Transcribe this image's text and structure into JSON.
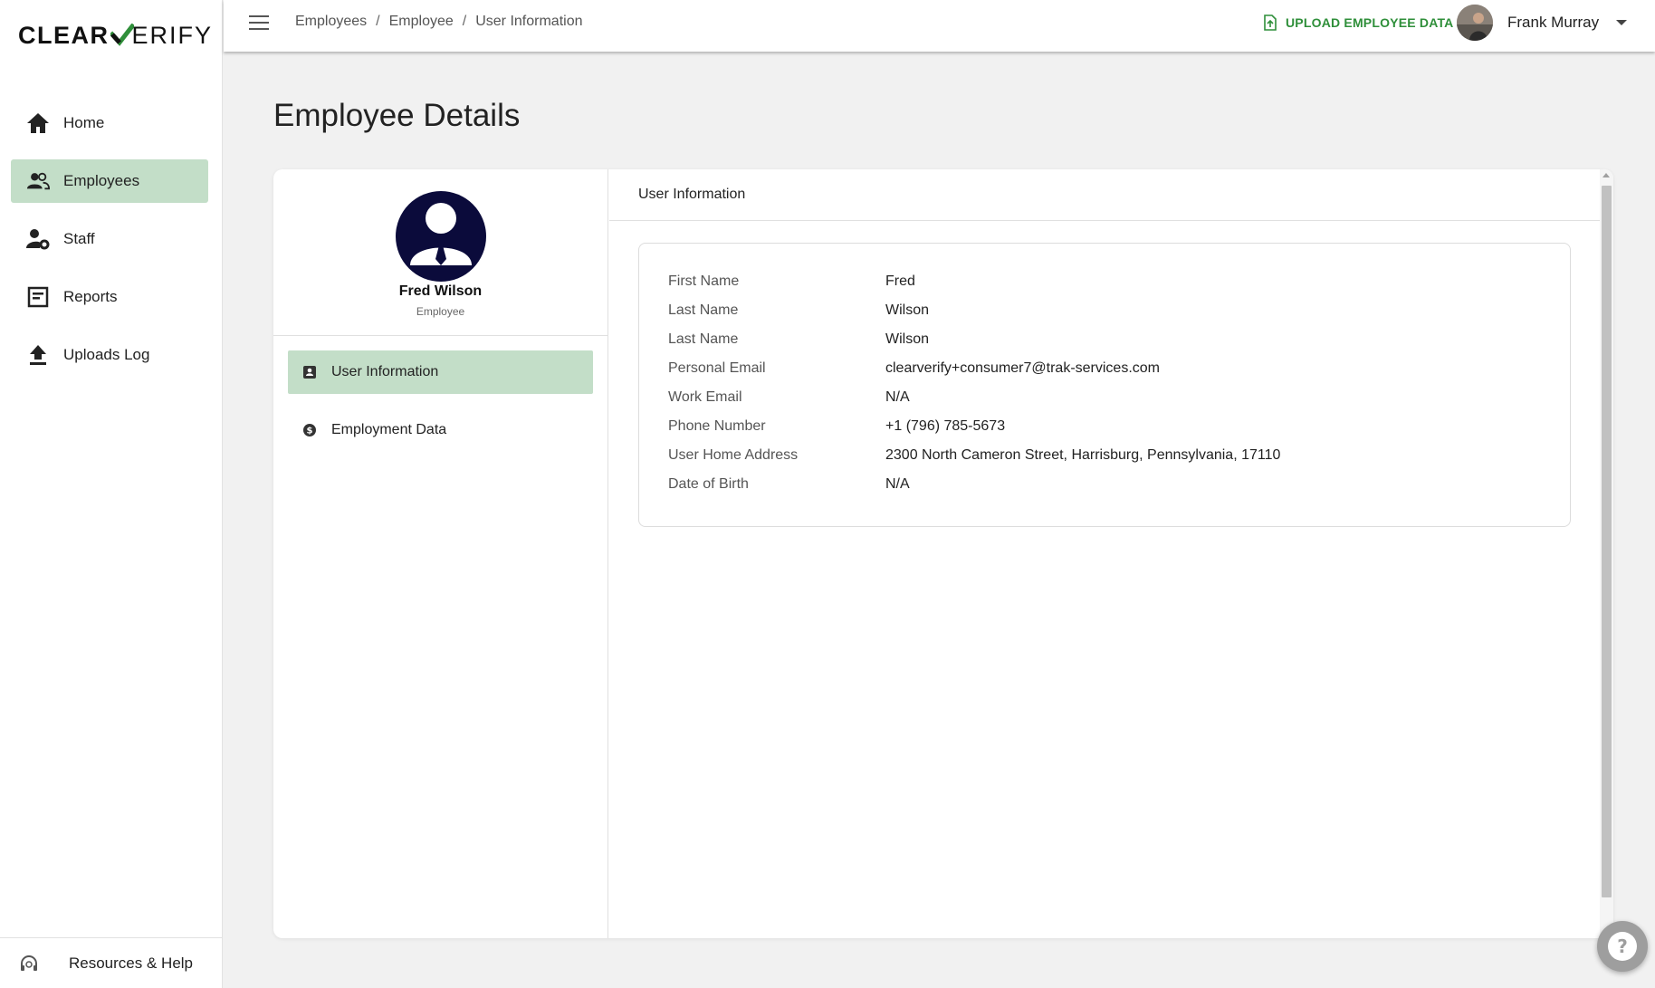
{
  "app": {
    "logo_part1": "CLEAR",
    "logo_part2": "ERIFY",
    "accent_color": "#2f8f3a",
    "active_bg": "#c3dec8"
  },
  "sidebar": {
    "items": [
      {
        "label": "Home",
        "icon": "home-icon"
      },
      {
        "label": "Employees",
        "icon": "people-icon",
        "active": true
      },
      {
        "label": "Staff",
        "icon": "staff-settings-icon"
      },
      {
        "label": "Reports",
        "icon": "report-icon"
      },
      {
        "label": "Uploads Log",
        "icon": "upload-icon"
      }
    ],
    "footer_label": "Resources & Help"
  },
  "header": {
    "breadcrumb": [
      "Employees",
      "Employee",
      "User Information"
    ],
    "breadcrumb_sep": "/",
    "upload_label": "UPLOAD EMPLOYEE DATA",
    "user_name": "Frank Murray"
  },
  "page": {
    "title": "Employee Details"
  },
  "profile": {
    "name": "Fred Wilson",
    "role": "Employee"
  },
  "side_menu": {
    "items": [
      {
        "label": "User Information",
        "icon": "contact-card-icon",
        "active": true
      },
      {
        "label": "Employment Data",
        "icon": "dollar-icon"
      }
    ]
  },
  "user_info": {
    "section_title": "User Information",
    "rows": [
      {
        "label": "First Name",
        "value": "Fred"
      },
      {
        "label": "Last Name",
        "value": "Wilson"
      },
      {
        "label": "Last Name",
        "value": "Wilson"
      },
      {
        "label": "Personal Email",
        "value": "clearverify+consumer7@trak-services.com"
      },
      {
        "label": "Work Email",
        "value": "N/A"
      },
      {
        "label": "Phone Number",
        "value": "+1 (796) 785-5673"
      },
      {
        "label": "User Home Address",
        "value": "2300 North Cameron Street, Harrisburg, Pennsylvania, 17110"
      },
      {
        "label": "Date of Birth",
        "value": "N/A"
      }
    ]
  }
}
